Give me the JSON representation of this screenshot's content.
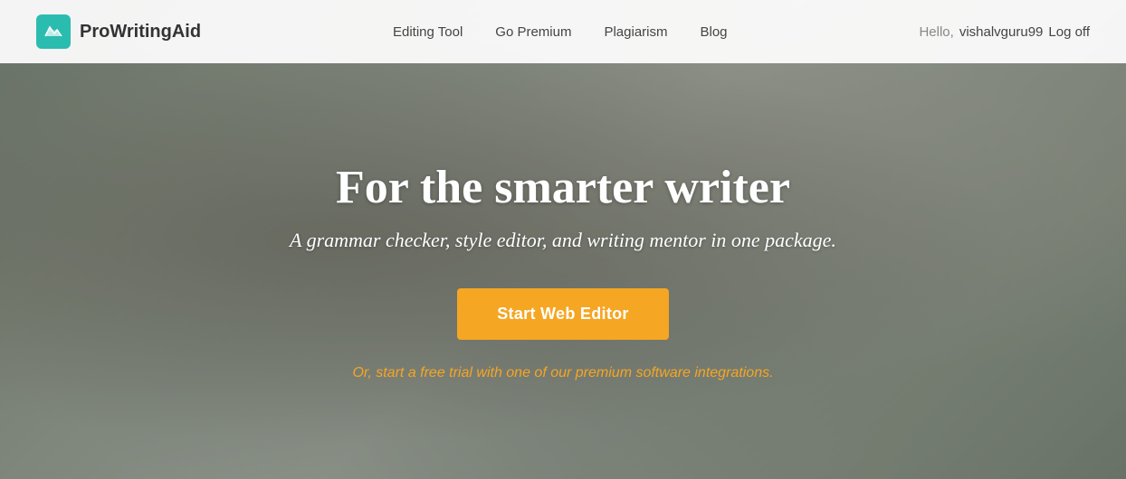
{
  "logo": {
    "text": "ProWritingAid",
    "icon_alt": "prowritingaid-logo-icon"
  },
  "nav": {
    "links": [
      {
        "label": "Editing Tool",
        "id": "editing-tool"
      },
      {
        "label": "Go Premium",
        "id": "go-premium"
      },
      {
        "label": "Plagiarism",
        "id": "plagiarism"
      },
      {
        "label": "Blog",
        "id": "blog"
      }
    ],
    "user": {
      "hello": "Hello,",
      "username": "vishalvguru99",
      "logoff_label": "Log off"
    }
  },
  "hero": {
    "title": "For the smarter writer",
    "subtitle": "A grammar checker, style editor, and writing mentor in one package.",
    "cta_label": "Start Web Editor",
    "trial_text": "Or, start a free trial with one of our premium software integrations."
  },
  "colors": {
    "accent_teal": "#2bbcb0",
    "accent_orange": "#f5a623",
    "nav_bg": "rgba(255,255,255,0.92)"
  }
}
